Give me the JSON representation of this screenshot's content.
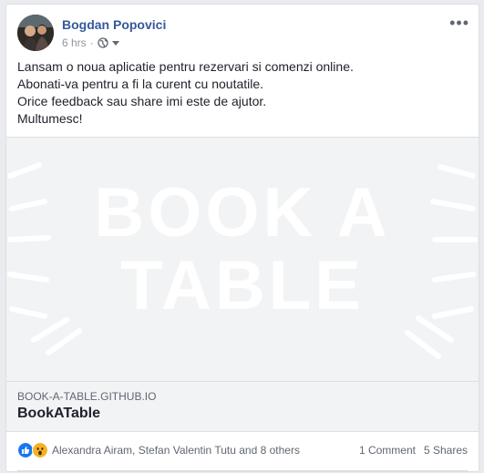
{
  "post": {
    "author": "Bogdan Popovici",
    "time": "6 hrs",
    "dot": "·",
    "more_icon": "more-horizontal-icon",
    "privacy_icon": "globe-icon",
    "text_lines": [
      "Lansam o noua aplicatie pentru rezervari si comenzi online.",
      "Abonati-va pentru a fi la curent cu noutatile.",
      "Orice feedback sau share imi este de ajutor.",
      "Multumesc!"
    ]
  },
  "link": {
    "image_text_line1": "BOOK A",
    "image_text_line2": "TABLE",
    "domain": "BOOK-A-TABLE.GITHUB.IO",
    "title": "BookATable"
  },
  "footer": {
    "reaction_icons": [
      "like-icon",
      "wow-icon"
    ],
    "reactors": "Alexandra Airam, Stefan Valentin Tutu and 8 others",
    "comments": "1 Comment",
    "shares": "5 Shares"
  },
  "colors": {
    "author": "#365899",
    "link_bg": "#f2f3f5",
    "like": "#1877f2",
    "wow": "#f7b125"
  }
}
